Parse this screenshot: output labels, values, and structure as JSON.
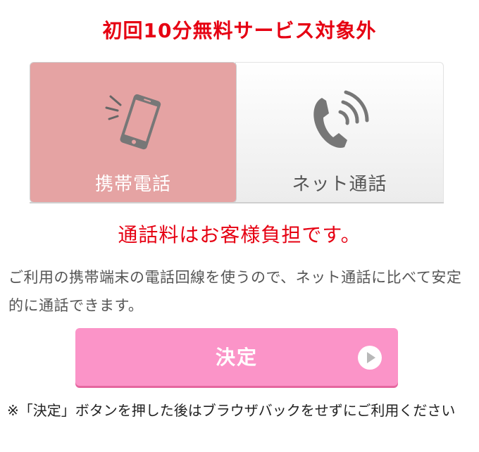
{
  "headline": "初回10分無料サービス対象外",
  "options": {
    "mobile": {
      "label": "携帯電話",
      "icon": "smartphone-icon",
      "selected": true
    },
    "net": {
      "label": "ネット通話",
      "icon": "phone-handset-icon",
      "selected": false
    }
  },
  "fee_note": "通話料はお客様負担です。",
  "description": "ご利用の携帯端末の電話回線を使うので、ネット通話に比べて安定的に通話できます。",
  "decide_button": {
    "label": "決定",
    "icon": "play-circle-icon"
  },
  "footnote": "※「決定」ボタンを押した後はブラウザバックをせずにご利用ください",
  "colors": {
    "accent_red": "#e60012",
    "selected_option": "#e5a3a3",
    "button_pink": "#fb94c8"
  }
}
